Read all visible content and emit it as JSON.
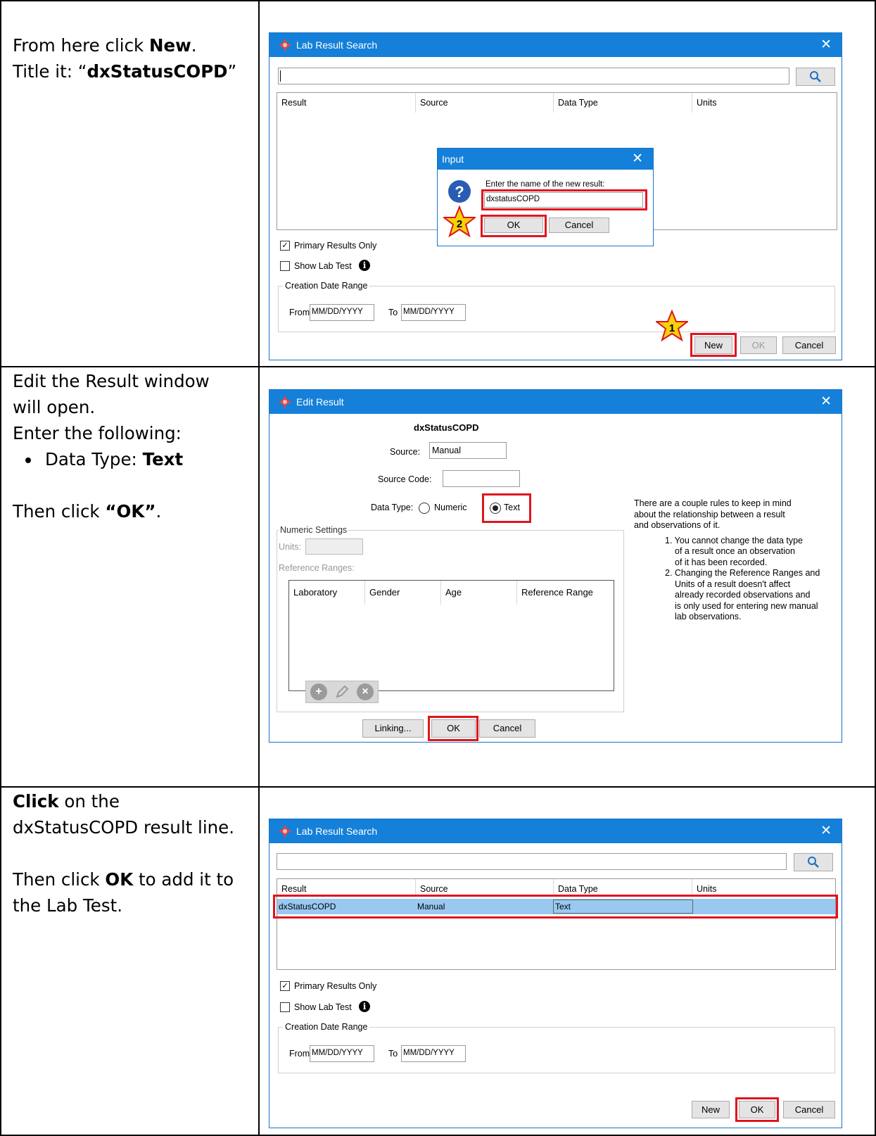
{
  "rows": [
    {
      "instruction": {
        "line1_pre": "From here click ",
        "line1_bold": "New",
        "line1_post": ".",
        "line2_pre": "Title it: “",
        "line2_bold": "dxStatusCOPD",
        "line2_post": "”"
      }
    },
    {
      "instruction": {
        "line1": "Edit the Result window",
        "line2": "will open.",
        "line3": "Enter the following:",
        "bullet_pre": "Data Type: ",
        "bullet_bold": "Text",
        "then_pre": "Then click ",
        "then_bold": "“OK”",
        "then_post": "."
      }
    },
    {
      "instruction": {
        "line1_bold": "Click",
        "line1_post": " on the",
        "line2": "dxStatusCOPD result line.",
        "line3_pre": "Then click ",
        "line3_bold": "OK",
        "line3_post": " to add it to",
        "line4": "the Lab Test."
      }
    }
  ],
  "lab_search": {
    "title": "Lab Result Search",
    "search_icon": "magnifier-icon",
    "columns": [
      "Result",
      "Source",
      "Data Type",
      "Units"
    ],
    "primary_only": "Primary Results Only",
    "show_lab_test": "Show Lab Test",
    "date_range": "Creation Date Range",
    "from": "From",
    "to": "To",
    "date_placeholder": "MM/DD/YYYY",
    "new": "New",
    "ok": "OK",
    "cancel": "Cancel"
  },
  "input_dialog": {
    "title": "Input",
    "prompt": "Enter the name of the new result:",
    "value": "dxstatusCOPD",
    "ok": "OK",
    "cancel": "Cancel"
  },
  "steps": {
    "one": "1",
    "two": "2"
  },
  "edit_result": {
    "title": "Edit Result",
    "name": "dxStatusCOPD",
    "source_label": "Source:",
    "source_value": "Manual",
    "source_code_label": "Source Code:",
    "data_type_label": "Data Type:",
    "numeric": "Numeric",
    "text": "Text",
    "selected_data_type": "Text",
    "numeric_settings": "Numeric Settings",
    "units_label": "Units:",
    "reference_ranges": "Reference Ranges:",
    "ref_columns": [
      "Laboratory",
      "Gender",
      "Age",
      "Reference Range"
    ],
    "rules_intro": [
      "There are a couple rules to keep in mind",
      "about the relationship between a result",
      "and observations of it."
    ],
    "rule1": [
      "1. You cannot change the data type",
      "of a result once an observation",
      "of it has been recorded."
    ],
    "rule2": [
      "2. Changing the Reference Ranges and",
      "Units of a result doesn't affect",
      "already recorded observations and",
      "is only used for entering new manual",
      "lab observations."
    ],
    "linking": "Linking...",
    "ok": "OK",
    "cancel": "Cancel"
  },
  "lab_search_result": {
    "row": {
      "result": "dxStatusCOPD",
      "source": "Manual",
      "data_type": "Text",
      "units": ""
    }
  },
  "colors": {
    "titlebar": "#1580d9",
    "highlight": "#e0151d",
    "selected_row": "#99c9f0",
    "star": "#f5d20a"
  }
}
